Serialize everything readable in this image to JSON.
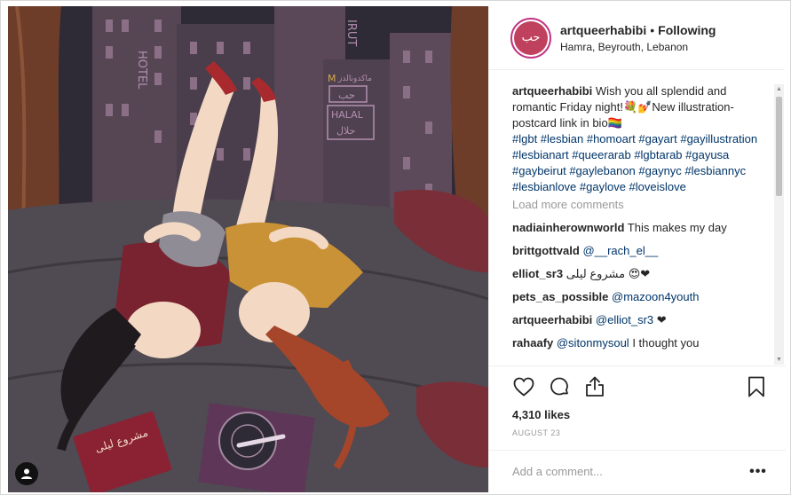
{
  "post": {
    "username": "artqueerhabibi",
    "separator": "•",
    "follow_status": "Following",
    "location": "Hamra, Beyrouth, Lebanon",
    "avatar_text": "حب",
    "image_text": {
      "hotel_sign": "HOTEL",
      "irut_sign": "IRUT",
      "mcd_text": "ماكدونالدز",
      "hob_sign": "حب",
      "halal_latin": "HALAL",
      "halal_arabic": "حلال",
      "book_title": "مشروع ليلى"
    }
  },
  "caption": {
    "username": "artqueerhabibi",
    "text": " Wish you all splendid and romantic Friday night!💐💅New illustration-postcard link in bio🏳️‍🌈",
    "hashtags": "#lgbt #lesbian #homoart #gayart #gayillustration #lesbianart #queerarab #lgbtarab #gayusa #gaybeirut #gaylebanon #gaynyc #lesbiannyc #lesbianlove #gaylove #loveislove"
  },
  "load_more": "Load more comments",
  "comments": [
    {
      "user": "nadiainherownworld",
      "text": " This makes my day",
      "mention": ""
    },
    {
      "user": "brittgottvald",
      "text": "",
      "mention": " @__rach_el__"
    },
    {
      "user": "elliot_sr3",
      "text": " مشروع ليلى 😍❤",
      "mention": ""
    },
    {
      "user": "pets_as_possible",
      "text": "",
      "mention": " @mazoon4youth"
    },
    {
      "user": "artqueerhabibi",
      "text": " ❤",
      "mention": " @elliot_sr3"
    },
    {
      "user": "rahaafy",
      "text": " I thought you",
      "mention": " @sitonmysoul"
    }
  ],
  "likes": "4,310 likes",
  "date": "AUGUST 23",
  "add_comment_placeholder": "Add a comment...",
  "more_options": "•••",
  "icons": {
    "heart": "heart-icon",
    "comment": "comment-icon",
    "share": "share-icon",
    "bookmark": "bookmark-icon",
    "user_tag": "user-tag-icon"
  },
  "colors": {
    "link": "#003569",
    "muted": "#999999",
    "avatar_bg": "#c0415e",
    "avatar_ring": "#c13584"
  }
}
